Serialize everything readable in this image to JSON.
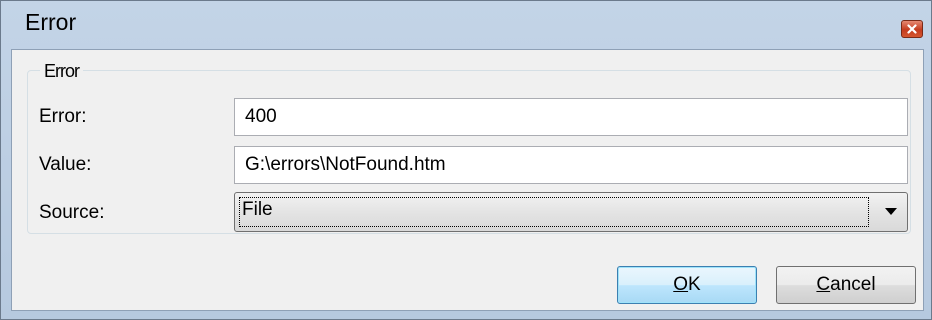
{
  "window": {
    "title": "Error"
  },
  "group": {
    "legend": "Error"
  },
  "fields": {
    "error_label": "Error:",
    "error_value": "400",
    "value_label": "Value:",
    "value_value": "G:\\errors\\NotFound.htm",
    "source_label": "Source:",
    "source_selected": "File"
  },
  "buttons": {
    "ok_mnemonic": "O",
    "ok_rest": "K",
    "cancel_mnemonic": "C",
    "cancel_rest": "ancel"
  },
  "icons": {
    "close": "close-icon",
    "dropdown": "chevron-down-icon"
  },
  "colors": {
    "titlebar": "#c3d4e7",
    "close_button": "#c43b1e",
    "default_button_border": "#3c7fb1"
  }
}
